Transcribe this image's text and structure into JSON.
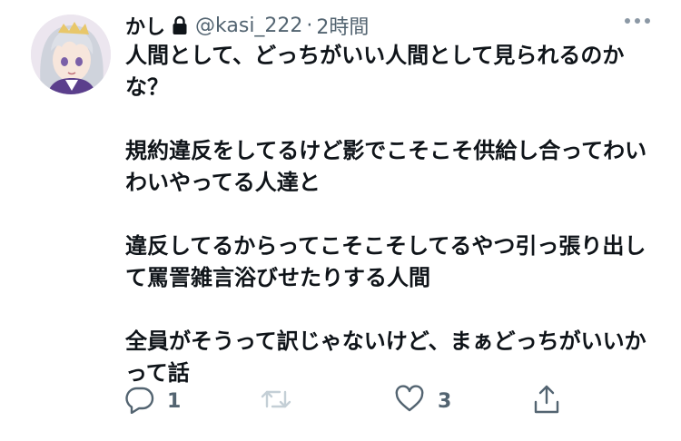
{
  "author": {
    "display_name": "かし",
    "handle": "@kasi_222",
    "separator": "·",
    "timestamp": "2時間",
    "protected": true
  },
  "body": {
    "paragraphs": [
      "人間として、どっちがいい人間として見られるのかな？",
      "規約違反をしてるけど影でこそこそ供給し合ってわいわいやってる人達と",
      "違反してるからってこそこそしてるやつ引っ張り出して罵詈雑言浴びせたりする人間",
      "全員がそうって訳じゃないけど、まぁどっちがいいかって話"
    ]
  },
  "actions": {
    "reply_count": "1",
    "retweet_count": "",
    "like_count": "3"
  },
  "icons": {
    "avatar": "anime-character-avatar",
    "lock": "lock-icon",
    "more": "more-icon",
    "reply": "reply-icon",
    "retweet": "retweet-icon",
    "like": "heart-icon",
    "share": "share-icon"
  },
  "colors": {
    "text": "#0f1419",
    "secondary": "#536471",
    "icon": "#536471",
    "retweet_icon": "#c4cfd6",
    "background": "#ffffff"
  }
}
